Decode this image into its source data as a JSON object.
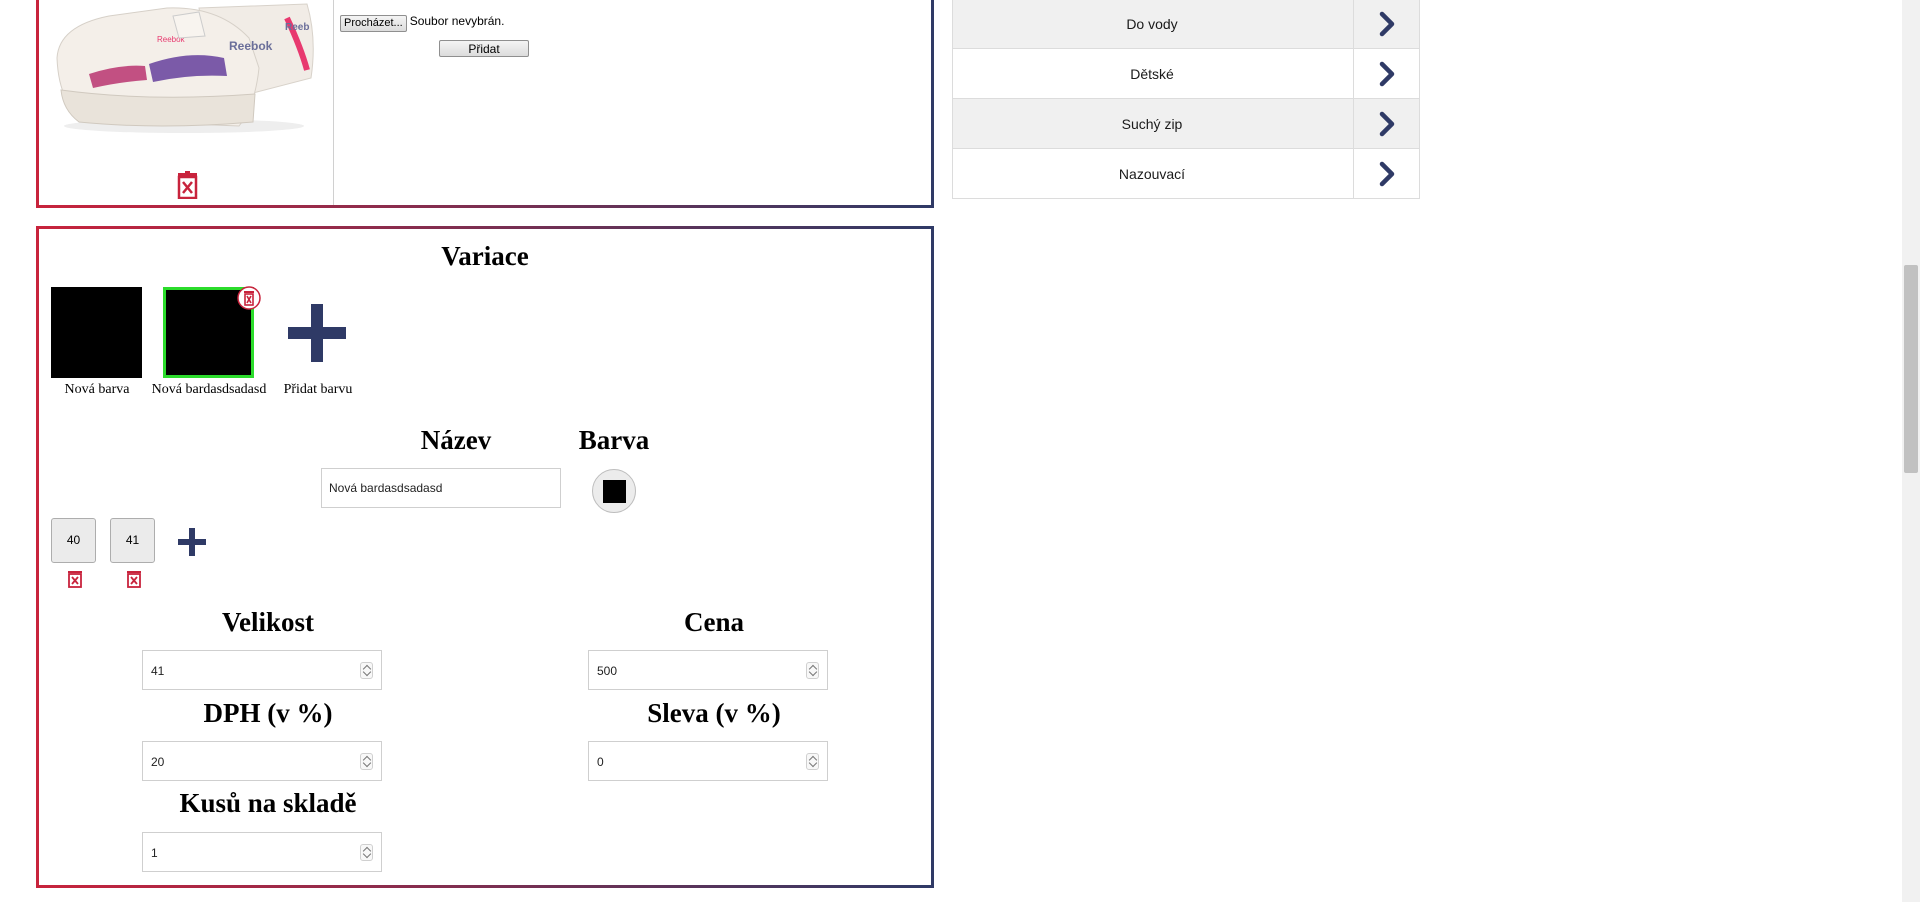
{
  "image_panel": {
    "browse_button": "Procházet...",
    "no_file_text": "Soubor nevybrán.",
    "add_button": "Přidat"
  },
  "categories": {
    "items": [
      {
        "label": "Do vody"
      },
      {
        "label": "Dětské"
      },
      {
        "label": "Suchý zip"
      },
      {
        "label": "Nazouvací"
      }
    ]
  },
  "variants": {
    "title": "Variace",
    "colors": [
      {
        "label": "Nová barva",
        "color": "#000000",
        "selected": false
      },
      {
        "label": "Nová bardasdsadasd",
        "color": "#000000",
        "selected": true
      }
    ],
    "add_color_label": "Přidat barvu",
    "name_heading": "Název",
    "color_heading": "Barva",
    "name_value": "Nová bardasdsadasd",
    "selected_color": "#000000",
    "sizes": [
      "40",
      "41"
    ],
    "fields": {
      "velikost": {
        "label": "Velikost",
        "value": "41"
      },
      "cena": {
        "label": "Cena",
        "value": "500"
      },
      "dph": {
        "label": "DPH (v %)",
        "value": "20"
      },
      "sleva": {
        "label": "Sleva (v %)",
        "value": "0"
      },
      "kusu": {
        "label": "Kusů na skladě",
        "value": "1"
      }
    }
  },
  "colors": {
    "accent_red": "#c8233c",
    "accent_navy": "#2f3a66",
    "selected_outline": "#2bdc2b"
  }
}
